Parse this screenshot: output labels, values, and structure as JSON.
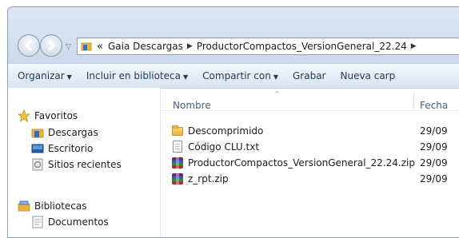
{
  "address_bar": {
    "overflow_glyph": "«",
    "crumbs": [
      "Gaia Descargas",
      "ProductorCompactos_VersionGeneral_22.24"
    ]
  },
  "toolbar": {
    "organize": "Organizar",
    "include_library": "Incluir en biblioteca",
    "share_with": "Compartir con",
    "burn": "Grabar",
    "new_folder": "Nueva carp"
  },
  "nav_pane": {
    "favorites": {
      "label": "Favoritos",
      "items": [
        "Descargas",
        "Escritorio",
        "Sitios recientes"
      ]
    },
    "libraries": {
      "label": "Bibliotecas",
      "items": [
        "Documentos"
      ]
    }
  },
  "file_list": {
    "columns": {
      "name": "Nombre",
      "date": "Fecha"
    },
    "items": [
      {
        "name": "Descomprimido",
        "date": "29/09",
        "icon": "folder-icon"
      },
      {
        "name": "Código CLU.txt",
        "date": "29/09",
        "icon": "text-file-icon"
      },
      {
        "name": "ProductorCompactos_VersionGeneral_22.24.zip",
        "date": "29/09",
        "icon": "winrar-archive-icon"
      },
      {
        "name": "z_rpt.zip",
        "date": "29/09",
        "icon": "winrar-archive-icon"
      }
    ]
  },
  "colors": {
    "chrome_blue": "#d4e1f0",
    "toolbar_text": "#1e395b",
    "header_text": "#4c607a"
  }
}
